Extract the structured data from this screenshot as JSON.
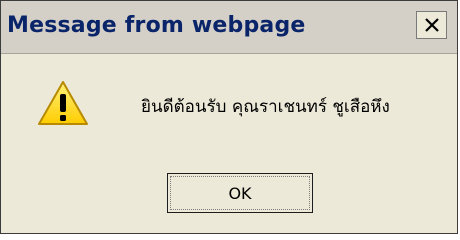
{
  "window": {
    "title": "Message from webpage",
    "close_icon": "close-icon"
  },
  "content": {
    "icon": "warning-icon",
    "message": "ยินดีต้อนรับ คุณราเชนทร์ ชูเสือหึง"
  },
  "buttons": {
    "ok_label": "OK"
  },
  "colors": {
    "title_text": "#0a246a",
    "dialog_bg": "#ece9d8",
    "warning_fill": "#ffd400"
  }
}
